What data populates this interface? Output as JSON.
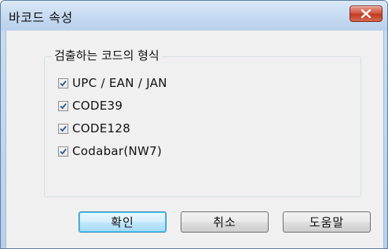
{
  "window": {
    "title": "바코드 속성"
  },
  "group": {
    "label": "검출하는 코드의 형식",
    "options": [
      {
        "label": "UPC / EAN / JAN",
        "checked": true
      },
      {
        "label": "CODE39",
        "checked": true
      },
      {
        "label": "CODE128",
        "checked": true
      },
      {
        "label": "Codabar(NW7)",
        "checked": true
      }
    ]
  },
  "buttons": {
    "ok": "확인",
    "cancel": "취소",
    "help": "도움말"
  },
  "colors": {
    "accent": "#3c7fb1",
    "close": "#c13b22",
    "check": "#2b5c8f"
  },
  "icons": {
    "close": "close-icon",
    "check": "checkmark-icon"
  }
}
